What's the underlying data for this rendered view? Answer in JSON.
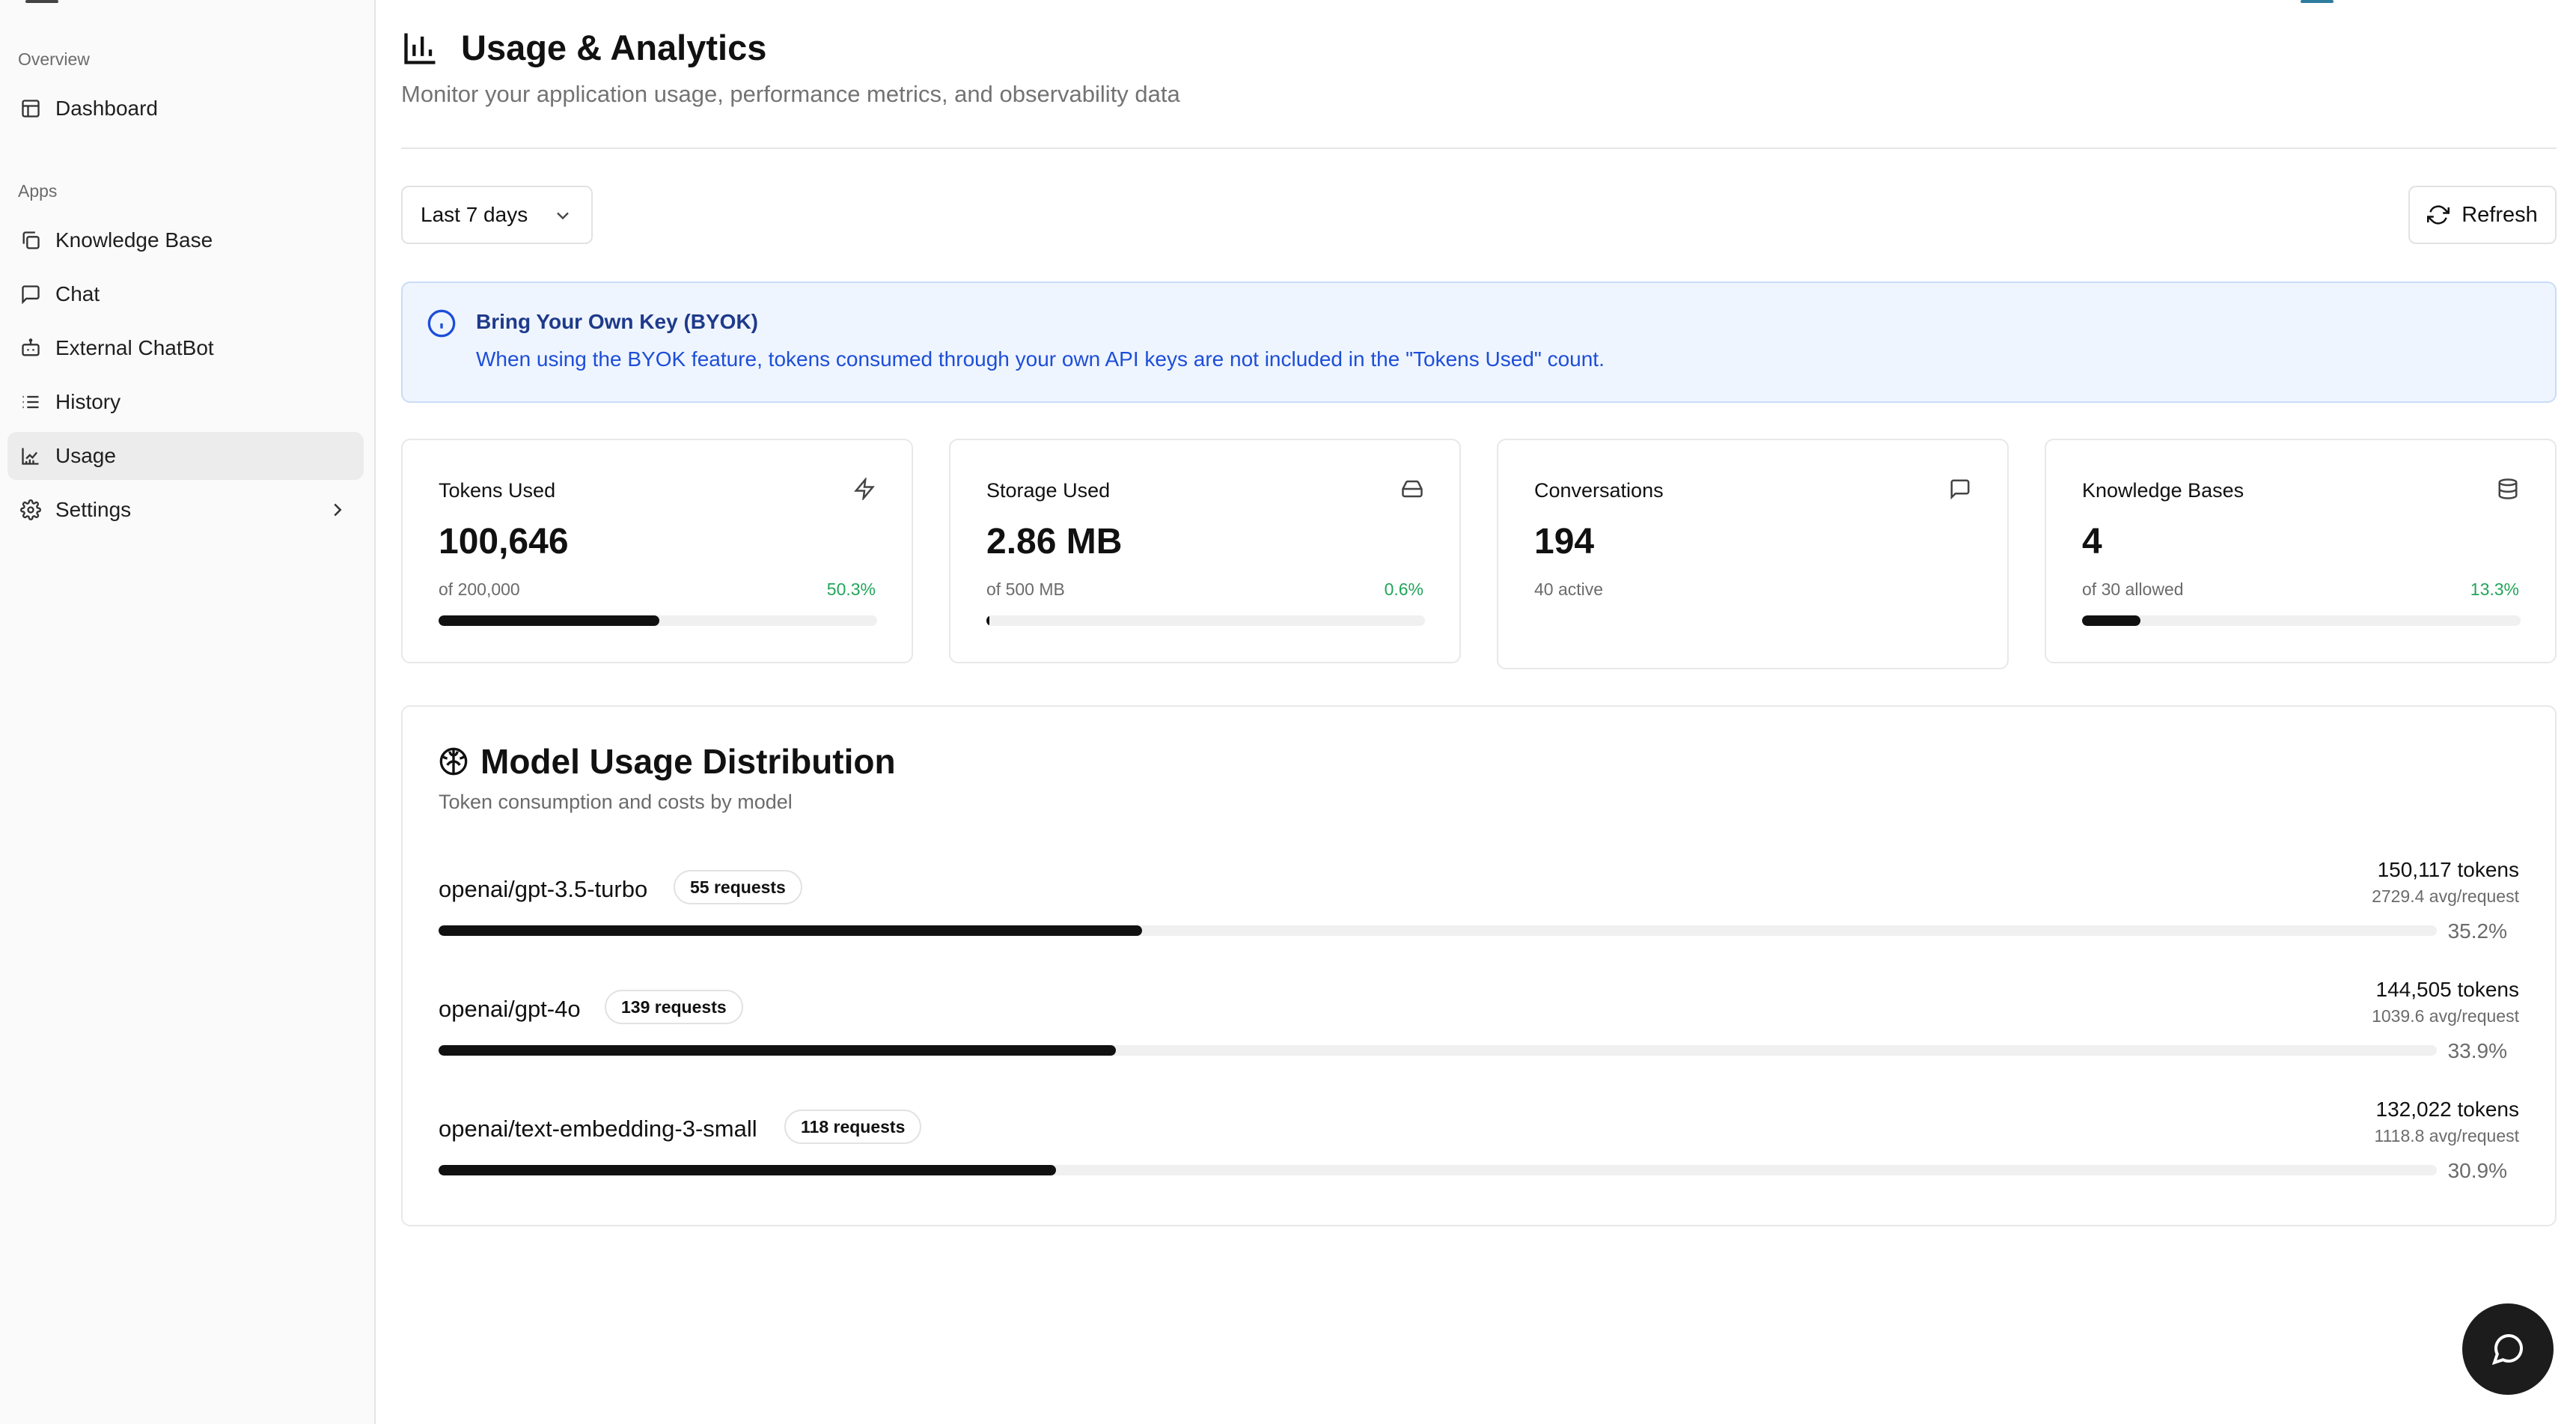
{
  "sidebar": {
    "sections": [
      {
        "label": "Overview",
        "items": [
          {
            "label": "Dashboard",
            "icon": "layout-icon"
          }
        ]
      },
      {
        "label": "Apps",
        "items": [
          {
            "label": "Knowledge Base",
            "icon": "copy-icon"
          },
          {
            "label": "Chat",
            "icon": "message-square-icon"
          },
          {
            "label": "External ChatBot",
            "icon": "bot-icon"
          },
          {
            "label": "History",
            "icon": "list-icon"
          },
          {
            "label": "Usage",
            "icon": "chart-line-icon",
            "active": true
          },
          {
            "label": "Settings",
            "icon": "gear-icon",
            "has_submenu": true
          }
        ]
      }
    ]
  },
  "header": {
    "title": "Usage & Analytics",
    "subtitle": "Monitor your application usage, performance metrics, and observability data",
    "icon": "bar-chart-icon"
  },
  "toolbar": {
    "range_value": "Last 7 days",
    "refresh_label": "Refresh"
  },
  "notice": {
    "title": "Bring Your Own Key (BYOK)",
    "text": "When using the BYOK feature, tokens consumed through your own API keys are not included in the \"Tokens Used\" count.",
    "icon": "info-icon"
  },
  "stats": [
    {
      "label": "Tokens Used",
      "value": "100,646",
      "sub": "of 200,000",
      "percent": "50.3%",
      "progress": 0.503,
      "icon": "zap-icon"
    },
    {
      "label": "Storage Used",
      "value": "2.86 MB",
      "sub": "of 500 MB",
      "percent": "0.6%",
      "progress": 0.006,
      "icon": "hard-drive-icon"
    },
    {
      "label": "Conversations",
      "value": "194",
      "sub": "40 active",
      "icon": "message-square-icon"
    },
    {
      "label": "Knowledge Bases",
      "value": "4",
      "sub": "of 30 allowed",
      "percent": "13.3%",
      "progress": 0.133,
      "icon": "database-icon"
    }
  ],
  "model_usage": {
    "title": "Model Usage Distribution",
    "subtitle": "Token consumption and costs by model",
    "icon": "brain-icon",
    "models": [
      {
        "name": "openai/gpt-3.5-turbo",
        "requests": "55 requests",
        "tokens": "150,117 tokens",
        "avg": "2729.4 avg/request",
        "percent": "35.2%",
        "share": 0.352
      },
      {
        "name": "openai/gpt-4o",
        "requests": "139 requests",
        "tokens": "144,505 tokens",
        "avg": "1039.6 avg/request",
        "percent": "33.9%",
        "share": 0.339
      },
      {
        "name": "openai/text-embedding-3-small",
        "requests": "118 requests",
        "tokens": "132,022 tokens",
        "avg": "1118.8 avg/request",
        "percent": "30.9%",
        "share": 0.309
      }
    ]
  },
  "colors": {
    "accent_dark": "#111111",
    "success": "#22a55a",
    "info_bg": "#eff5ff",
    "info_text": "#1d4ed8"
  }
}
